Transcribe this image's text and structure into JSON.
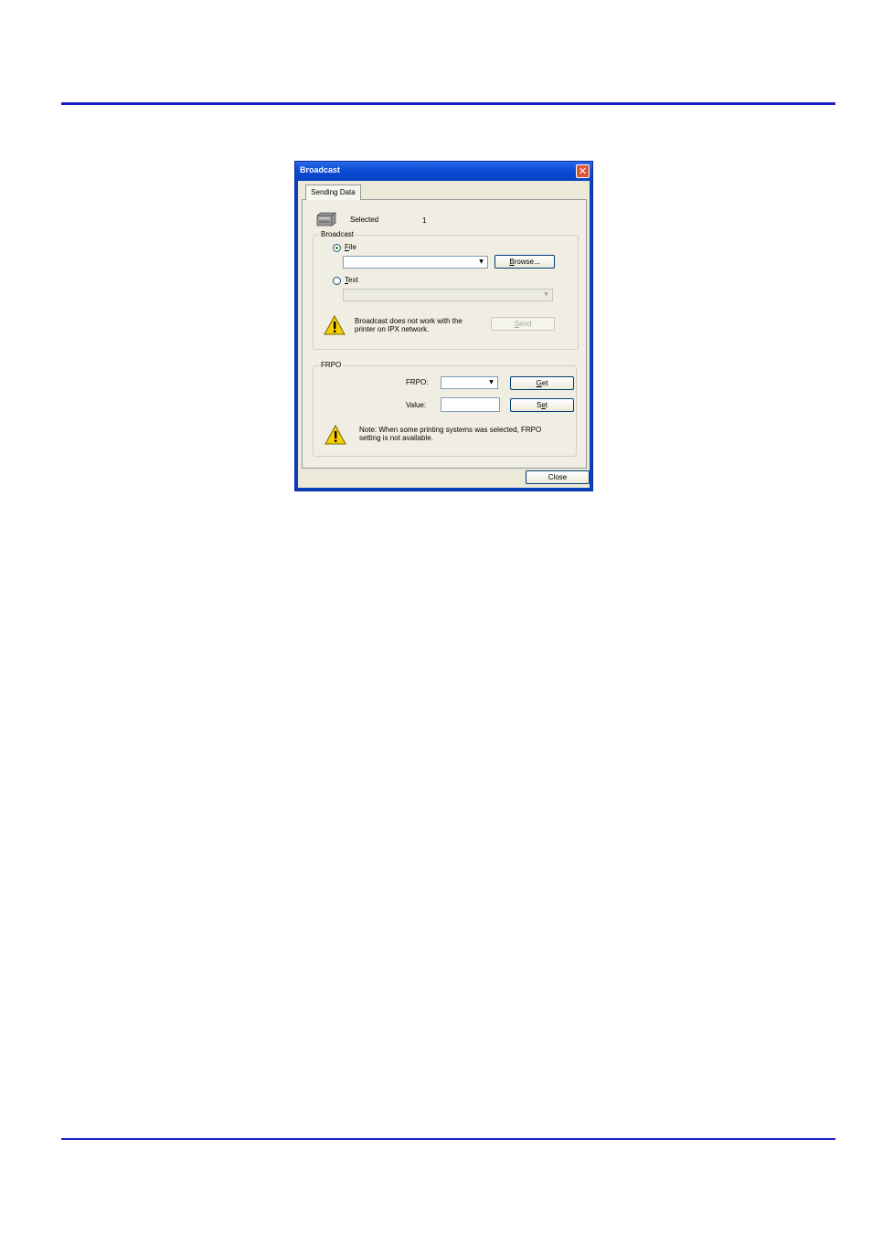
{
  "window": {
    "title": "Broadcast"
  },
  "tabs": [
    {
      "label": "Sending Data"
    }
  ],
  "selected": {
    "label": "Selected",
    "count": "1"
  },
  "broadcast": {
    "group_title": "Broadcast",
    "file_radio": {
      "label_accesskey": "F",
      "label_rest": "ile",
      "checked": true
    },
    "file_combo": {
      "value": ""
    },
    "browse_button": {
      "label_accesskey": "B",
      "label_rest": "rowse..."
    },
    "text_radio": {
      "label_accesskey": "T",
      "label_rest": "ext",
      "checked": false
    },
    "text_combo": {
      "value": "",
      "disabled": true
    },
    "warning_line1": "Broadcast does not work with the",
    "warning_line2": "printer on IPX network.",
    "send_button": {
      "label_accesskey": "S",
      "label_rest": "end",
      "disabled": true
    }
  },
  "frpo": {
    "group_title": "FRPO",
    "frpo_label": "FRPO:",
    "frpo_combo": {
      "value": ""
    },
    "get_button": {
      "label_accesskey": "G",
      "label_rest": "et"
    },
    "value_label": "Value:",
    "value_input": {
      "value": ""
    },
    "set_button": {
      "label_pre": "S",
      "label_accesskey": "e",
      "label_post": "t"
    },
    "note_line1": "Note: When some printing systems was selected, FRPO",
    "note_line2": "setting is not available."
  },
  "close_button": {
    "label": "Close"
  },
  "icons": {
    "printer": "printer-icon",
    "warning": "warning-icon",
    "close": "close-icon",
    "dropdown": "chevron-down-icon"
  },
  "colors": {
    "page_rule": "#1a20c8",
    "title_bar": "#0b4bd6",
    "dialog_face": "#ece9d8",
    "close_button": "#d9563a"
  }
}
